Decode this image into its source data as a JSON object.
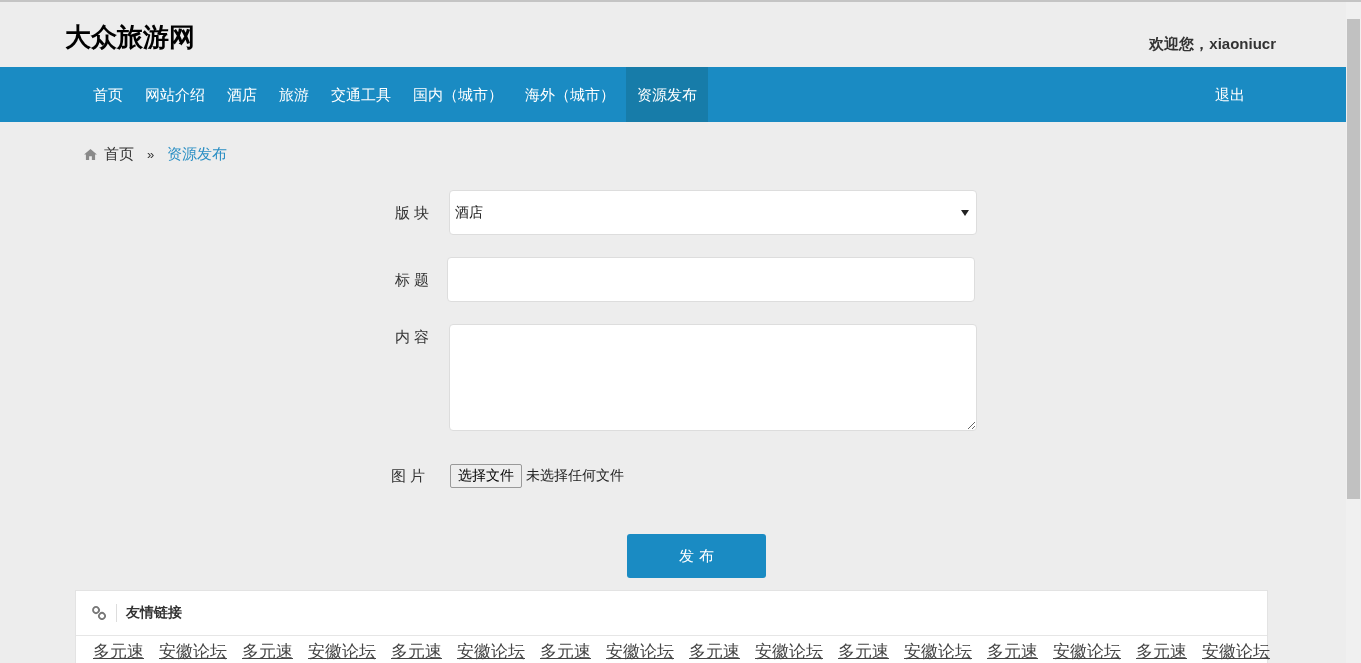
{
  "header": {
    "site_title": "大众旅游网",
    "welcome": "欢迎您，xiaoniucr"
  },
  "nav": {
    "items": [
      {
        "label": "首页",
        "selected": false
      },
      {
        "label": "网站介绍",
        "selected": false
      },
      {
        "label": "酒店",
        "selected": false
      },
      {
        "label": "旅游",
        "selected": false
      },
      {
        "label": "交通工具",
        "selected": false
      },
      {
        "label": "国内（城市）",
        "selected": false
      },
      {
        "label": "海外（城市）",
        "selected": false
      },
      {
        "label": "资源发布",
        "selected": true
      }
    ],
    "logout": "退出"
  },
  "breadcrumb": [
    {
      "label": "首页",
      "current": false
    },
    {
      "label": "»",
      "kind": "sep"
    },
    {
      "label": "资源发布",
      "current": true
    }
  ],
  "form": {
    "fields": [
      {
        "kind": "select",
        "label": "版 块",
        "value": "酒店"
      },
      {
        "kind": "text",
        "label": "标 题"
      },
      {
        "kind": "textarea",
        "label": "内 容"
      },
      {
        "kind": "file",
        "label": "图 片",
        "button": "选择文件",
        "status": "未选择任何文件"
      }
    ],
    "submit": "发 布"
  },
  "links_panel": {
    "title": "友情链接",
    "links": [
      "多元速",
      "安徽论坛",
      "多元速",
      "安徽论坛",
      "多元速",
      "安徽论坛",
      "多元速",
      "安徽论坛",
      "多元速",
      "安徽论坛",
      "多元速",
      "安徽论坛",
      "多元速",
      "安徽论坛",
      "多元速",
      "安徽论坛"
    ]
  }
}
